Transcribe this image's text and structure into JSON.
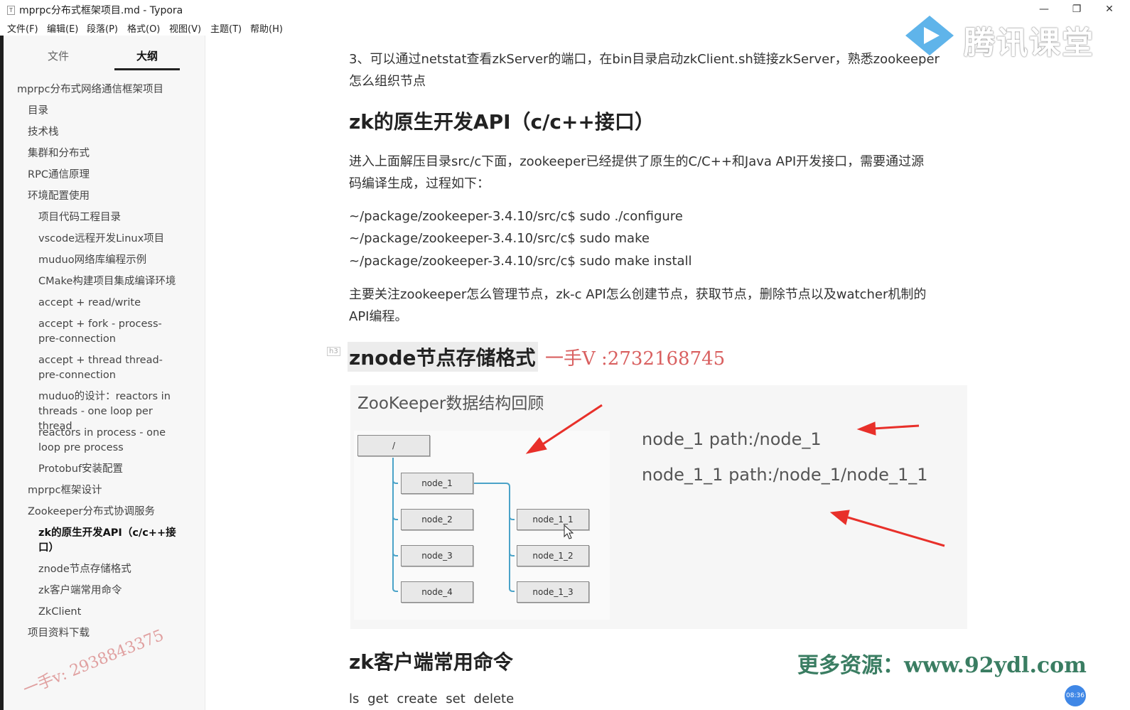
{
  "window": {
    "title": "mprpc分布式框架项目.md - Typora",
    "app_icon": "T",
    "minimize": "—",
    "maximize": "❐",
    "close": "✕"
  },
  "menu": [
    "文件(F)",
    "编辑(E)",
    "段落(P)",
    "格式(O)",
    "视图(V)",
    "主题(T)",
    "帮助(H)"
  ],
  "sidebar": {
    "tabs": [
      "文件",
      "大纲"
    ],
    "active_tab": "大纲",
    "toc": [
      {
        "label": "mprpc分布式网络通信框架项目",
        "level": 1
      },
      {
        "label": "目录",
        "level": 2
      },
      {
        "label": "技术栈",
        "level": 2
      },
      {
        "label": "集群和分布式",
        "level": 2
      },
      {
        "label": "RPC通信原理",
        "level": 2
      },
      {
        "label": "环境配置使用",
        "level": 2
      },
      {
        "label": "项目代码工程目录",
        "level": 3
      },
      {
        "label": "vscode远程开发Linux项目",
        "level": 3
      },
      {
        "label": "muduo网络库编程示例",
        "level": 3
      },
      {
        "label": "CMake构建项目集成编译环境",
        "level": 3
      },
      {
        "label": "accept + read/write",
        "level": 3
      },
      {
        "label": "accept + fork - process-pre-connection",
        "level": 3
      },
      {
        "label": "accept + thread thread-pre-connection",
        "level": 3
      },
      {
        "label": "muduo的设计：reactors in threads - one loop per thread",
        "level": 3
      },
      {
        "label": "reactors in process - one loop pre process",
        "level": 3
      },
      {
        "label": "Protobuf安装配置",
        "level": 3
      },
      {
        "label": "mprpc框架设计",
        "level": 2
      },
      {
        "label": "Zookeeper分布式协调服务",
        "level": 2
      },
      {
        "label": "zk的原生开发API（c/c++接口）",
        "level": 3,
        "active": true
      },
      {
        "label": "znode节点存储格式",
        "level": 3
      },
      {
        "label": "zk客户端常用命令",
        "level": 3
      },
      {
        "label": "ZkClient",
        "level": 3
      },
      {
        "label": "项目资料下载",
        "level": 2
      }
    ],
    "watermark": "一手v: 2938843375"
  },
  "content": {
    "step3_line1": "3、可以通过netstat查看zkServer的端口，在bin目录启动zkClient.sh链接zkServer，熟悉zookeeper",
    "step3_line2": "怎么组织节点",
    "h2_api": "zk的原生开发API（c/c++接口）",
    "intro_line1": "进入上面解压目录src/c下面，zookeeper已经提供了原生的C/C++和Java API开发接口，需要通过源",
    "intro_line2": "码编译生成，过程如下：",
    "cmd1": "~/package/zookeeper-3.4.10/src/c$ sudo ./configure",
    "cmd2": "~/package/zookeeper-3.4.10/src/c$ sudo make",
    "cmd3": "~/package/zookeeper-3.4.10/src/c$ sudo make install",
    "focus_line1": "主要关注zookeeper怎么管理节点，zk-c API怎么创建节点，获取节点，删除节点以及watcher机制的",
    "focus_line2": "API编程。",
    "h3_marker": "h3",
    "h3_znode": "znode节点存储格式",
    "handnote": "一手V :2732168745",
    "figure": {
      "title": "ZooKeeper数据结构回顾",
      "root": "/",
      "nodes_left": [
        "node_1",
        "node_2",
        "node_3",
        "node_4"
      ],
      "nodes_right": [
        "node_1_1",
        "node_1_2",
        "node_1_3"
      ],
      "path1": "node_1 path:/node_1",
      "path2": "node_1_1 path:/node_1/node_1_1",
      "arrow_color": "#e8302a"
    },
    "h2_client": "zk客户端常用命令",
    "commands": "ls    get    create    set    delete"
  },
  "overlays": {
    "tencent_logo_text": "腾讯课堂",
    "resource_watermark": "更多资源：www.92ydl.com",
    "clock": "08:36"
  }
}
